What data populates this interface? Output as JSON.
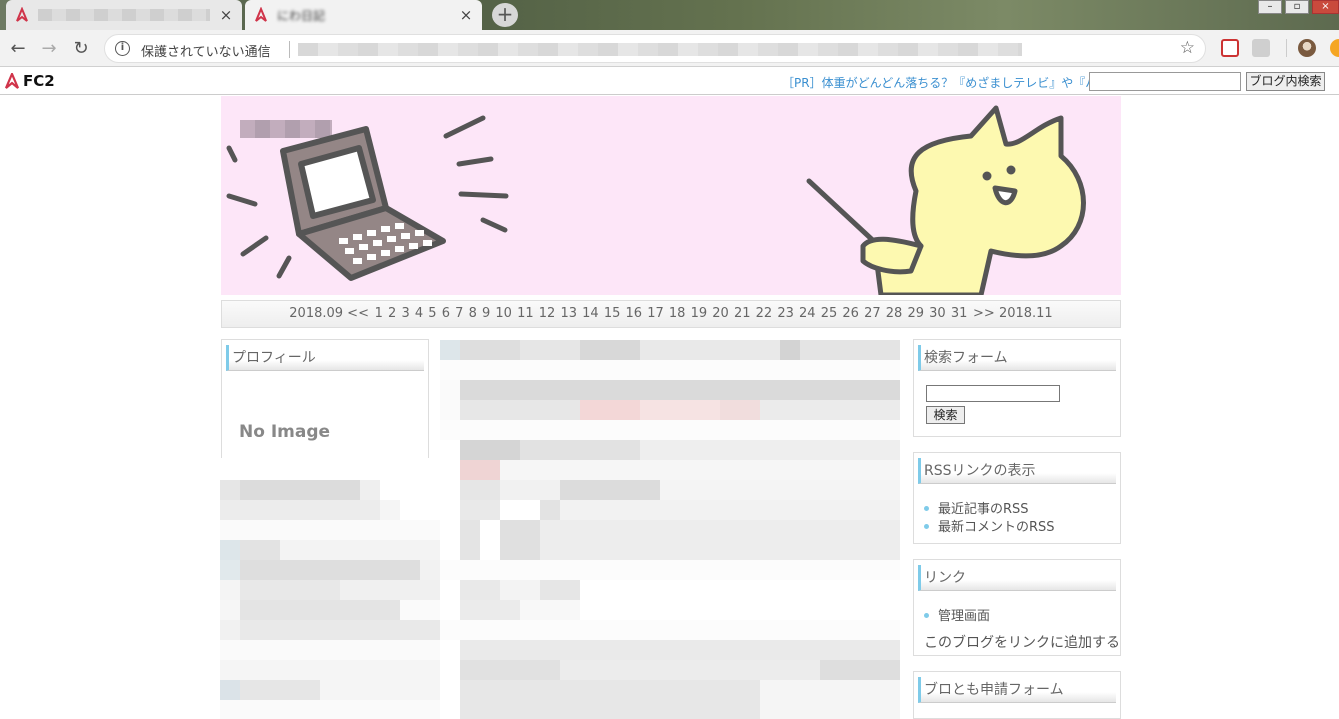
{
  "browser": {
    "tabs": [
      {
        "title": ""
      },
      {
        "title": "にわ日記"
      }
    ],
    "insecure_label": "保護されていない通信"
  },
  "fc2bar": {
    "logo": "FC2",
    "ad": "［PR］体重がどんどん落ちる？『めざましテレビ』や『バイキン",
    "search_button": "ブログ内検索",
    "search_placeholder": ""
  },
  "calendar": {
    "prev": "2018.09 <<",
    "days": [
      "1",
      "2",
      "3",
      "4",
      "5",
      "6",
      "7",
      "8",
      "9",
      "10",
      "11",
      "12",
      "13",
      "14",
      "15",
      "16",
      "17",
      "18",
      "19",
      "20",
      "21",
      "22",
      "23",
      "24",
      "25",
      "26",
      "27",
      "28",
      "29",
      "30",
      "31"
    ],
    "next": ">> 2018.11"
  },
  "left": {
    "profile_title": "プロフィール",
    "no_image": "No Image"
  },
  "right": {
    "search_title": "検索フォーム",
    "search_button": "検索",
    "rss_title": "RSSリンクの表示",
    "rss_items": [
      "最近記事のRSS",
      "最新コメントのRSS"
    ],
    "link_title": "リンク",
    "link_items": [
      "管理画面"
    ],
    "add_link": "このブログをリンクに追加する",
    "friend_title": "ブロとも申請フォーム"
  },
  "colors": {
    "accent": "#7fcbe9",
    "header_bg": "#fde6f8",
    "cat_fill": "#fdf9b0"
  }
}
